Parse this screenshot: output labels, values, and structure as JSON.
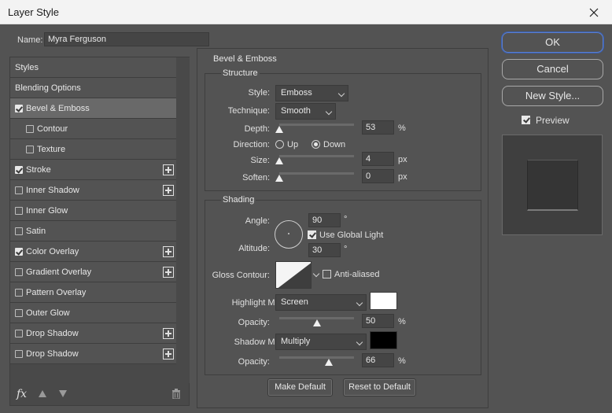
{
  "window": {
    "title": "Layer Style"
  },
  "name": {
    "label": "Name:",
    "value": "Myra Ferguson"
  },
  "left": {
    "items": [
      {
        "label": "Styles",
        "checkbox": false,
        "checked": false,
        "plus": false,
        "sub": false,
        "active": false
      },
      {
        "label": "Blending Options",
        "checkbox": false,
        "checked": false,
        "plus": false,
        "sub": false,
        "active": false
      },
      {
        "label": "Bevel & Emboss",
        "checkbox": true,
        "checked": true,
        "plus": false,
        "sub": false,
        "active": true
      },
      {
        "label": "Contour",
        "checkbox": true,
        "checked": false,
        "plus": false,
        "sub": true,
        "active": false
      },
      {
        "label": "Texture",
        "checkbox": true,
        "checked": false,
        "plus": false,
        "sub": true,
        "active": false
      },
      {
        "label": "Stroke",
        "checkbox": true,
        "checked": true,
        "plus": true,
        "sub": false,
        "active": false
      },
      {
        "label": "Inner Shadow",
        "checkbox": true,
        "checked": false,
        "plus": true,
        "sub": false,
        "active": false
      },
      {
        "label": "Inner Glow",
        "checkbox": true,
        "checked": false,
        "plus": false,
        "sub": false,
        "active": false
      },
      {
        "label": "Satin",
        "checkbox": true,
        "checked": false,
        "plus": false,
        "sub": false,
        "active": false
      },
      {
        "label": "Color Overlay",
        "checkbox": true,
        "checked": true,
        "plus": true,
        "sub": false,
        "active": false
      },
      {
        "label": "Gradient Overlay",
        "checkbox": true,
        "checked": false,
        "plus": true,
        "sub": false,
        "active": false
      },
      {
        "label": "Pattern Overlay",
        "checkbox": true,
        "checked": false,
        "plus": false,
        "sub": false,
        "active": false
      },
      {
        "label": "Outer Glow",
        "checkbox": true,
        "checked": false,
        "plus": false,
        "sub": false,
        "active": false
      },
      {
        "label": "Drop Shadow",
        "checkbox": true,
        "checked": false,
        "plus": true,
        "sub": false,
        "active": false
      },
      {
        "label": "Drop Shadow",
        "checkbox": true,
        "checked": false,
        "plus": true,
        "sub": false,
        "active": false
      }
    ],
    "footer": {
      "fx_label": "fx"
    }
  },
  "bevel": {
    "title": "Bevel & Emboss",
    "structure": {
      "title": "Structure",
      "style_label": "Style:",
      "style_value": "Emboss",
      "technique_label": "Technique:",
      "technique_value": "Smooth",
      "depth_label": "Depth:",
      "depth_value": "53",
      "depth_unit": "%",
      "depth_fraction": 0.0,
      "direction_label": "Direction:",
      "up_label": "Up",
      "down_label": "Down",
      "direction_selected": "Down",
      "size_label": "Size:",
      "size_value": "4",
      "size_unit": "px",
      "size_fraction": 0.0,
      "soften_label": "Soften:",
      "soften_value": "0",
      "soften_unit": "px",
      "soften_fraction": 0.0
    },
    "shading": {
      "title": "Shading",
      "angle_label": "Angle:",
      "angle_value": "90",
      "angle_unit": "°",
      "global_light_label": "Use Global Light",
      "global_light_checked": true,
      "altitude_label": "Altitude:",
      "altitude_value": "30",
      "altitude_unit": "°",
      "gloss_label": "Gloss Contour:",
      "anti_aliased_label": "Anti-aliased",
      "anti_aliased_checked": false,
      "highlight_mode_label": "Highlight Mode:",
      "highlight_mode_value": "Screen",
      "highlight_color": "#ffffff",
      "highlight_opacity_label": "Opacity:",
      "highlight_opacity_value": "50",
      "highlight_opacity_unit": "%",
      "highlight_opacity_fraction": 0.5,
      "shadow_mode_label": "Shadow Mode:",
      "shadow_mode_value": "Multiply",
      "shadow_color": "#000000",
      "shadow_opacity_label": "Opacity:",
      "shadow_opacity_value": "66",
      "shadow_opacity_unit": "%",
      "shadow_opacity_fraction": 0.66
    },
    "make_default_label": "Make Default",
    "reset_default_label": "Reset to Default"
  },
  "right": {
    "ok_label": "OK",
    "cancel_label": "Cancel",
    "new_style_label": "New Style...",
    "preview_label": "Preview",
    "preview_checked": true
  }
}
